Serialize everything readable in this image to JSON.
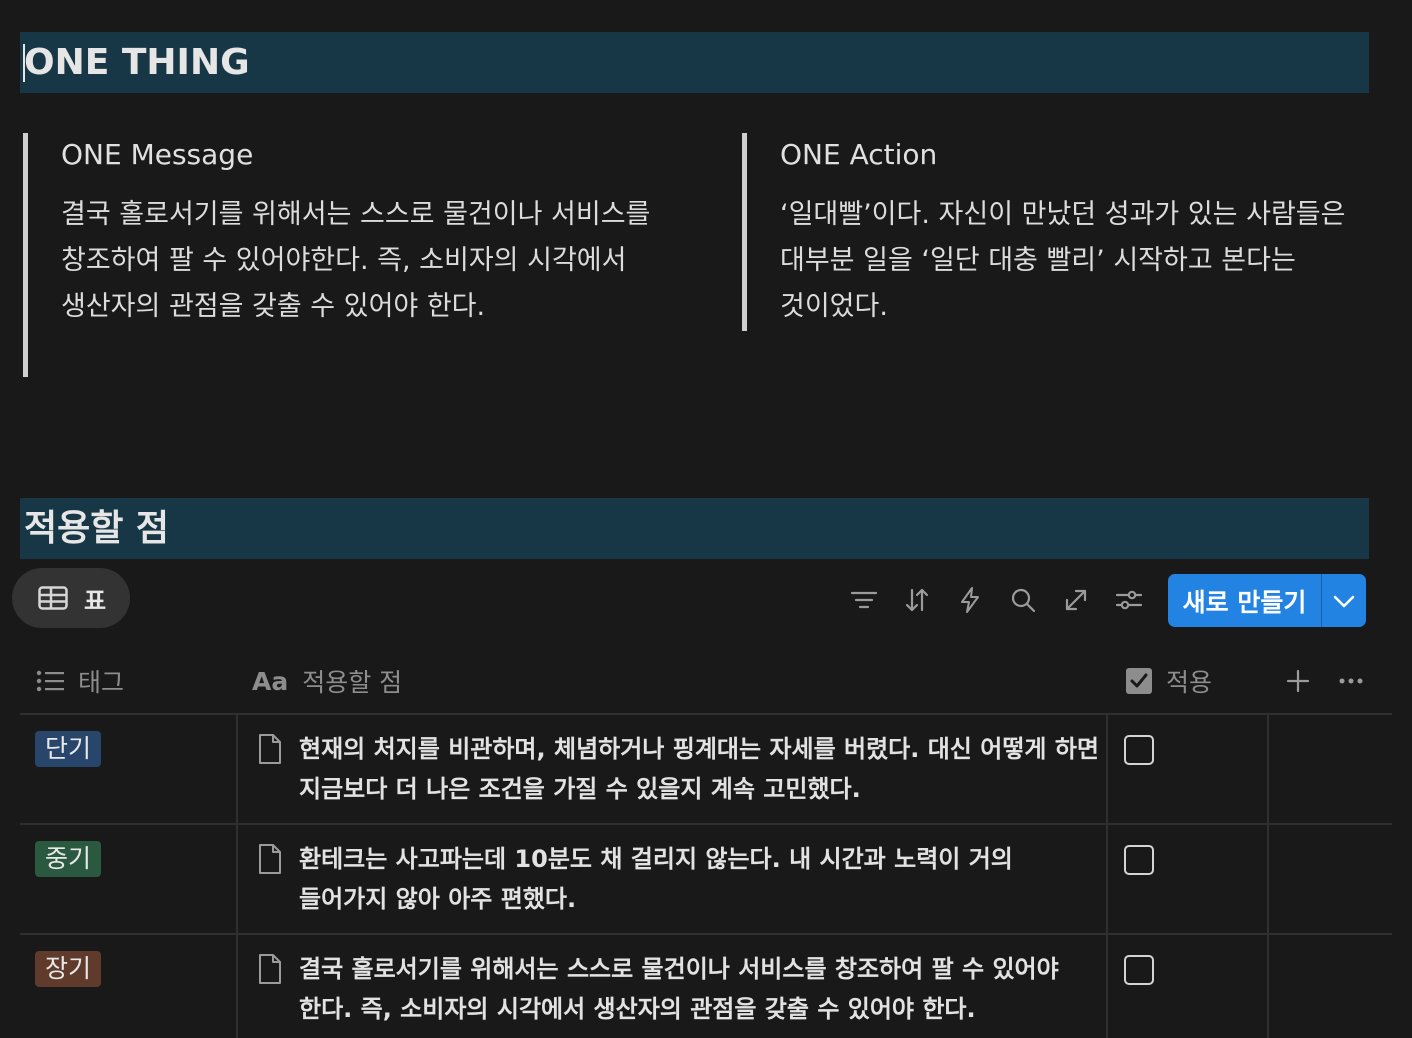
{
  "one_thing": {
    "heading": "ONE THING",
    "message": {
      "title": "ONE Message",
      "body": "결국 홀로서기를 위해서는 스스로 물건이나 서비스를 창조하여 팔 수 있어야한다. 즉, 소비자의 시각에서 생산자의 관점을 갖출 수 있어야 한다."
    },
    "action": {
      "title": "ONE Action",
      "body": "‘일대빨’이다. 자신이 만났던 성과가 있는 사람들은 대부분 일을 ‘일단 대충 빨리’ 시작하고 본다는 것이었다."
    }
  },
  "apply": {
    "heading": "적용할 점"
  },
  "database": {
    "view_tab": {
      "label": "표",
      "icon": "table-icon"
    },
    "toolbar": {
      "icons": [
        "filter-icon",
        "sort-icon",
        "lightning-icon",
        "search-icon",
        "expand-icon",
        "settings-icon"
      ]
    },
    "new_button": {
      "label": "새로 만들기",
      "dropdown_icon": "chevron-down-icon"
    },
    "columns": {
      "tag": {
        "label": "태그",
        "icon": "list-icon"
      },
      "point": {
        "label": "적용할 점",
        "icon": "text-aa-icon"
      },
      "applied": {
        "label": "적용",
        "icon": "checkbox-checked-icon"
      }
    },
    "rows": [
      {
        "tag": "단기",
        "tag_color": "#28456c",
        "text": "현재의 처지를 비관하며, 체념하거나 핑계대는 자세를 버렸다. 대신 어떻게 하면 지금보다 더 나은 조건을 가질 수 있을지 계속 고민했다.",
        "applied": false
      },
      {
        "tag": "중기",
        "tag_color": "#2b593f",
        "text": "환테크는 사고파는데 10분도 채 걸리지 않는다. 내 시간과 노력이 거의 들어가지 않아 아주 편했다.",
        "applied": false
      },
      {
        "tag": "장기",
        "tag_color": "#603b2c",
        "text": "결국 홀로서기를 위해서는 스스로 물건이나 서비스를 창조하여 팔 수 있어야 한다. 즉, 소비자의 시각에서 생산자의 관점을 갖출 수 있어야 한다.",
        "applied": false
      }
    ]
  }
}
